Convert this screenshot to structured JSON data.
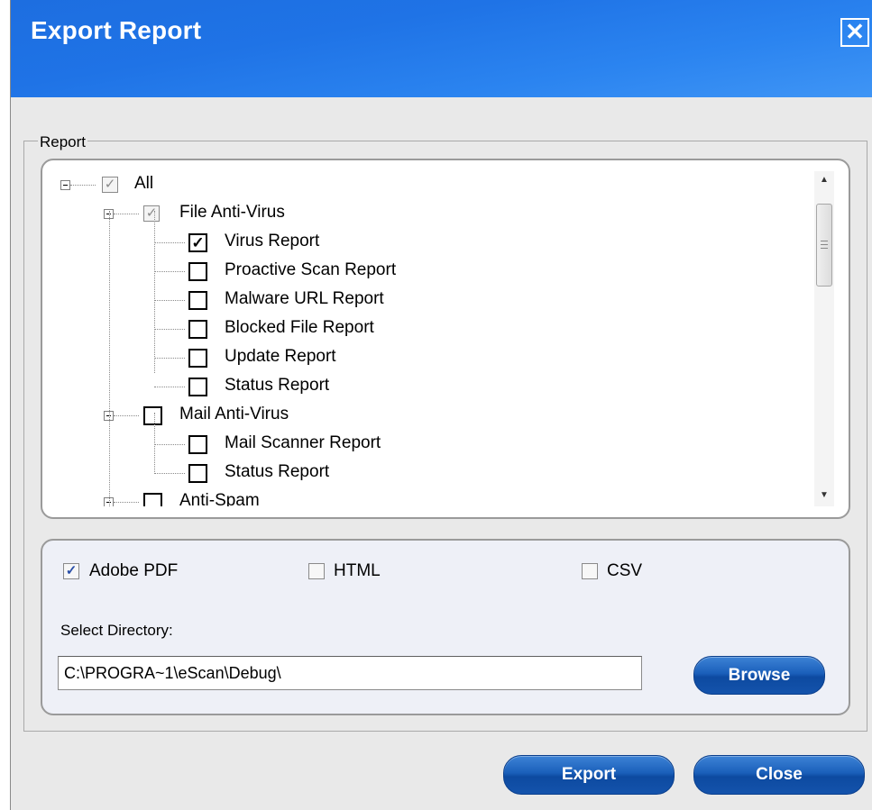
{
  "window": {
    "title": "Export Report"
  },
  "report_group": {
    "legend": "Report",
    "tree": [
      {
        "label": "All",
        "level": 0,
        "checked": "indeterminate"
      },
      {
        "label": "File Anti-Virus",
        "level": 1,
        "checked": "indeterminate"
      },
      {
        "label": "Virus Report",
        "level": 2,
        "checked": true
      },
      {
        "label": "Proactive Scan Report",
        "level": 2,
        "checked": false
      },
      {
        "label": "Malware URL Report",
        "level": 2,
        "checked": false
      },
      {
        "label": "Blocked File Report",
        "level": 2,
        "checked": false
      },
      {
        "label": "Update Report",
        "level": 2,
        "checked": false
      },
      {
        "label": "Status Report",
        "level": 2,
        "checked": false
      },
      {
        "label": "Mail Anti-Virus",
        "level": 1,
        "checked": false
      },
      {
        "label": "Mail Scanner Report",
        "level": 2,
        "checked": false
      },
      {
        "label": "Status Report",
        "level": 2,
        "checked": false
      },
      {
        "label": "Anti-Spam",
        "level": 1,
        "checked": false
      }
    ]
  },
  "formats": {
    "pdf": {
      "label": "Adobe PDF",
      "checked": true
    },
    "html": {
      "label": "HTML",
      "checked": false
    },
    "csv": {
      "label": "CSV",
      "checked": false
    }
  },
  "directory": {
    "label": "Select Directory:",
    "value": "C:\\PROGRA~1\\eScan\\Debug\\",
    "browse_label": "Browse"
  },
  "footer": {
    "export_label": "Export",
    "close_label": "Close"
  },
  "icons": {
    "close": "close-icon",
    "expand": "collapse-icon",
    "check": "checkmark-icon"
  }
}
